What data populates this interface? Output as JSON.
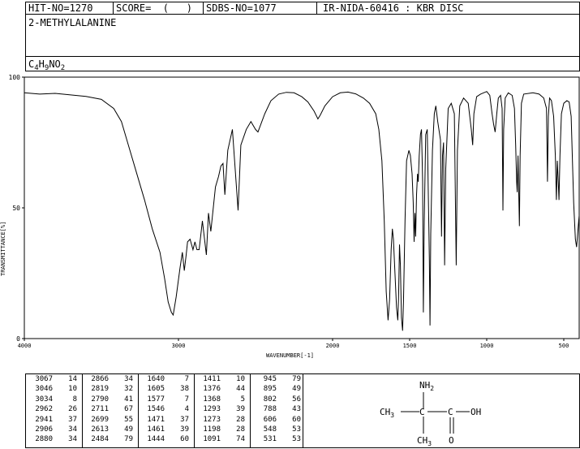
{
  "header": {
    "hit_no": "HIT-NO=1270",
    "score": "SCORE=  (   )",
    "sdbs_no": "SDBS-NO=1077",
    "method": "IR-NIDA-60416 : KBR DISC",
    "compound_name": "2-METHYLALANINE",
    "formula_parts": [
      {
        "t": "C",
        "sub": false
      },
      {
        "t": "4",
        "sub": true
      },
      {
        "t": "H",
        "sub": false
      },
      {
        "t": "9",
        "sub": true
      },
      {
        "t": "NO",
        "sub": false
      },
      {
        "t": "2",
        "sub": true
      }
    ]
  },
  "chart_data": {
    "type": "line",
    "xlabel": "WAVENUMBER[-1]",
    "ylabel": "TRANSMITTANCE[%]",
    "xlim": [
      4000,
      400
    ],
    "ylim": [
      0,
      100
    ],
    "x_ticks": [
      4000,
      3000,
      2000,
      1500,
      1000,
      500
    ],
    "y_ticks": [
      100,
      50,
      0
    ],
    "series": [
      {
        "points": [
          [
            4000,
            94
          ],
          [
            3900,
            93.5
          ],
          [
            3800,
            93.8
          ],
          [
            3700,
            93.2
          ],
          [
            3600,
            92.6
          ],
          [
            3500,
            91.5
          ],
          [
            3420,
            88
          ],
          [
            3370,
            83
          ],
          [
            3330,
            75
          ],
          [
            3280,
            65
          ],
          [
            3220,
            53
          ],
          [
            3170,
            42
          ],
          [
            3120,
            33
          ],
          [
            3090,
            23
          ],
          [
            3067,
            14
          ],
          [
            3046,
            10
          ],
          [
            3034,
            9
          ],
          [
            3015,
            16
          ],
          [
            2990,
            27
          ],
          [
            2975,
            33
          ],
          [
            2962,
            26
          ],
          [
            2950,
            32
          ],
          [
            2941,
            37
          ],
          [
            2925,
            38
          ],
          [
            2906,
            34
          ],
          [
            2893,
            37
          ],
          [
            2880,
            34
          ],
          [
            2866,
            34
          ],
          [
            2845,
            45
          ],
          [
            2819,
            32
          ],
          [
            2805,
            48
          ],
          [
            2790,
            41
          ],
          [
            2760,
            58
          ],
          [
            2740,
            62
          ],
          [
            2725,
            66
          ],
          [
            2711,
            67
          ],
          [
            2699,
            55
          ],
          [
            2680,
            72
          ],
          [
            2650,
            80
          ],
          [
            2613,
            49
          ],
          [
            2595,
            74
          ],
          [
            2560,
            80
          ],
          [
            2530,
            83
          ],
          [
            2500,
            80
          ],
          [
            2484,
            79
          ],
          [
            2440,
            86
          ],
          [
            2400,
            91
          ],
          [
            2350,
            93.5
          ],
          [
            2300,
            94.2
          ],
          [
            2250,
            94
          ],
          [
            2200,
            92.5
          ],
          [
            2160,
            90.5
          ],
          [
            2120,
            87
          ],
          [
            2095,
            84
          ],
          [
            2080,
            85.5
          ],
          [
            2050,
            89
          ],
          [
            2000,
            92.5
          ],
          [
            1950,
            94
          ],
          [
            1900,
            94.3
          ],
          [
            1850,
            93.6
          ],
          [
            1800,
            92
          ],
          [
            1760,
            90
          ],
          [
            1720,
            86
          ],
          [
            1700,
            80
          ],
          [
            1680,
            68
          ],
          [
            1665,
            45
          ],
          [
            1652,
            18
          ],
          [
            1640,
            7
          ],
          [
            1630,
            15
          ],
          [
            1620,
            34
          ],
          [
            1612,
            42
          ],
          [
            1605,
            38
          ],
          [
            1595,
            25
          ],
          [
            1585,
            12
          ],
          [
            1577,
            7
          ],
          [
            1572,
            15
          ],
          [
            1566,
            36
          ],
          [
            1560,
            28
          ],
          [
            1553,
            8
          ],
          [
            1546,
            3
          ],
          [
            1540,
            14
          ],
          [
            1530,
            45
          ],
          [
            1520,
            68
          ],
          [
            1505,
            72
          ],
          [
            1495,
            70
          ],
          [
            1484,
            63
          ],
          [
            1477,
            52
          ],
          [
            1471,
            37
          ],
          [
            1466,
            48
          ],
          [
            1461,
            39
          ],
          [
            1455,
            55
          ],
          [
            1449,
            63
          ],
          [
            1444,
            60
          ],
          [
            1438,
            70
          ],
          [
            1430,
            78
          ],
          [
            1423,
            80
          ],
          [
            1416,
            60
          ],
          [
            1411,
            10
          ],
          [
            1405,
            45
          ],
          [
            1396,
            78
          ],
          [
            1386,
            80
          ],
          [
            1376,
            44
          ],
          [
            1372,
            30
          ],
          [
            1368,
            5
          ],
          [
            1363,
            40
          ],
          [
            1352,
            72
          ],
          [
            1340,
            86
          ],
          [
            1330,
            89
          ],
          [
            1318,
            83
          ],
          [
            1300,
            76
          ],
          [
            1293,
            39
          ],
          [
            1287,
            70
          ],
          [
            1280,
            75
          ],
          [
            1273,
            28
          ],
          [
            1266,
            65
          ],
          [
            1250,
            88
          ],
          [
            1230,
            90
          ],
          [
            1210,
            86
          ],
          [
            1198,
            28
          ],
          [
            1190,
            72
          ],
          [
            1175,
            89
          ],
          [
            1150,
            92
          ],
          [
            1120,
            90
          ],
          [
            1100,
            80
          ],
          [
            1091,
            74
          ],
          [
            1083,
            86
          ],
          [
            1065,
            92.5
          ],
          [
            1040,
            93.5
          ],
          [
            1000,
            94.5
          ],
          [
            980,
            93
          ],
          [
            965,
            86
          ],
          [
            955,
            82
          ],
          [
            945,
            79
          ],
          [
            935,
            86
          ],
          [
            925,
            92
          ],
          [
            910,
            93
          ],
          [
            900,
            88
          ],
          [
            895,
            49
          ],
          [
            890,
            80
          ],
          [
            880,
            92
          ],
          [
            860,
            94
          ],
          [
            835,
            93
          ],
          [
            820,
            88
          ],
          [
            812,
            74
          ],
          [
            806,
            60
          ],
          [
            802,
            56
          ],
          [
            797,
            70
          ],
          [
            788,
            43
          ],
          [
            783,
            70
          ],
          [
            775,
            90
          ],
          [
            760,
            93.5
          ],
          [
            700,
            94
          ],
          [
            660,
            93.5
          ],
          [
            630,
            92
          ],
          [
            612,
            88
          ],
          [
            606,
            60
          ],
          [
            600,
            85
          ],
          [
            592,
            92
          ],
          [
            580,
            91
          ],
          [
            566,
            85
          ],
          [
            555,
            70
          ],
          [
            548,
            53
          ],
          [
            542,
            68
          ],
          [
            536,
            60
          ],
          [
            531,
            53
          ],
          [
            525,
            70
          ],
          [
            515,
            86
          ],
          [
            500,
            90
          ],
          [
            480,
            91
          ],
          [
            465,
            90.5
          ],
          [
            452,
            85
          ],
          [
            445,
            70
          ],
          [
            436,
            52
          ],
          [
            425,
            38
          ],
          [
            417,
            35
          ],
          [
            410,
            40
          ],
          [
            403,
            45
          ],
          [
            400,
            47
          ]
        ]
      }
    ]
  },
  "peak_table": [
    [
      [
        3067,
        14
      ],
      [
        3046,
        10
      ],
      [
        3034,
        8
      ],
      [
        2962,
        26
      ],
      [
        2941,
        37
      ],
      [
        2906,
        34
      ],
      [
        2880,
        34
      ]
    ],
    [
      [
        2866,
        34
      ],
      [
        2819,
        32
      ],
      [
        2790,
        41
      ],
      [
        2711,
        67
      ],
      [
        2699,
        55
      ],
      [
        2613,
        49
      ],
      [
        2484,
        79
      ]
    ],
    [
      [
        1640,
        7
      ],
      [
        1605,
        38
      ],
      [
        1577,
        7
      ],
      [
        1546,
        4
      ],
      [
        1471,
        37
      ],
      [
        1461,
        39
      ],
      [
        1444,
        60
      ]
    ],
    [
      [
        1411,
        10
      ],
      [
        1376,
        44
      ],
      [
        1368,
        5
      ],
      [
        1293,
        39
      ],
      [
        1273,
        28
      ],
      [
        1198,
        28
      ],
      [
        1091,
        74
      ]
    ],
    [
      [
        945,
        79
      ],
      [
        895,
        49
      ],
      [
        802,
        56
      ],
      [
        788,
        43
      ],
      [
        606,
        60
      ],
      [
        548,
        53
      ],
      [
        531,
        53
      ]
    ]
  ],
  "structure": {
    "nh2": "NH",
    "nh2_sub": "2",
    "ch3_left": "CH",
    "ch3_left_sub": "3",
    "c_center": "C",
    "c_carboxyl": "C",
    "oh": "OH",
    "o_double": "O",
    "ch3_bottom": "CH",
    "ch3_bottom_sub": "3"
  }
}
